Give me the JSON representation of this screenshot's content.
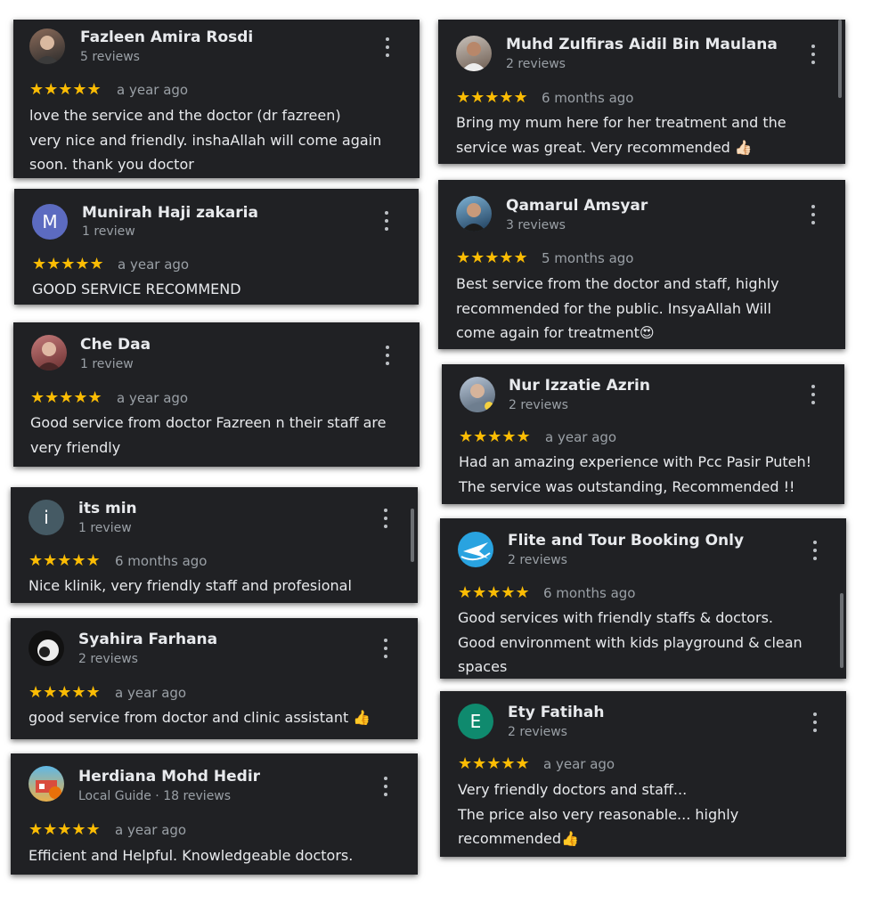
{
  "colors": {
    "card_bg": "#202124",
    "star": "#fbbc04",
    "text": "#e8eaed",
    "muted": "#9aa0a6"
  },
  "reviews": [
    {
      "name": "Fazleen Amira Rosdi",
      "sub": "5 reviews",
      "stars": "★★★★★",
      "time": "a year ago",
      "text": "love the service and the doctor (dr fazreen)\nvery nice and friendly. inshaAllah will come again\nsoon. thank you doctor",
      "avatar_icon": "person-photo-icon"
    },
    {
      "name": "Munirah Haji zakaria",
      "sub": "1 review",
      "stars": "★★★★★",
      "time": "a year ago",
      "text": "GOOD SERVICE RECOMMEND",
      "avatar_letter": "M"
    },
    {
      "name": "Che Daa",
      "sub": "1 review",
      "stars": "★★★★★",
      "time": "a year ago",
      "text": "Good service from doctor Fazreen n their staff are\nvery friendly",
      "avatar_icon": "person-photo-icon"
    },
    {
      "name": "its min",
      "sub": "1 review",
      "stars": "★★★★★",
      "time": "6 months ago",
      "text": "Nice klinik, very friendly staff and profesional",
      "avatar_letter": "i"
    },
    {
      "name": "Syahira Farhana",
      "sub": "2 reviews",
      "stars": "★★★★★",
      "time": "a year ago",
      "text": "good service from doctor and clinic assistant 👍",
      "avatar_icon": "person-photo-icon"
    },
    {
      "name": "Herdiana Mohd Hedir",
      "sub": "Local Guide · 18 reviews",
      "stars": "★★★★★",
      "time": "a year ago",
      "text": "Efficient and Helpful. Knowledgeable doctors.",
      "avatar_icon": "person-photo-icon"
    },
    {
      "name": "Muhd Zulfiras Aidil Bin Maulana",
      "sub": "2 reviews",
      "stars": "★★★★★",
      "time": "6 months ago",
      "text": "Bring my mum here for her treatment and the\nservice was great. Very recommended 👍🏻",
      "avatar_icon": "person-photo-icon"
    },
    {
      "name": "Qamarul Amsyar",
      "sub": "3 reviews",
      "stars": "★★★★★",
      "time": "5 months ago",
      "text": "Best service from the doctor and staff, highly\nrecommended for the public. InsyaAllah Will\ncome again for treatment😍",
      "avatar_icon": "person-photo-icon"
    },
    {
      "name": "Nur Izzatie Azrin",
      "sub": "2 reviews",
      "stars": "★★★★★",
      "time": "a year ago",
      "text": "Had an amazing experience with Pcc Pasir Puteh!\nThe service was outstanding, Recommended !!",
      "avatar_icon": "person-photo-icon"
    },
    {
      "name": "Flite and Tour Booking Only",
      "sub": "2 reviews",
      "stars": "★★★★★",
      "time": "6 months ago",
      "text": "Good services with friendly staffs & doctors.\nGood environment with kids playground & clean\nspaces",
      "avatar_icon": "plane-logo-icon"
    },
    {
      "name": "Ety Fatihah",
      "sub": "2 reviews",
      "stars": "★★★★★",
      "time": "a year ago",
      "text": "Very friendly doctors and staff...\nThe price also very reasonable... highly\nrecommended👍",
      "avatar_letter": "E"
    }
  ]
}
